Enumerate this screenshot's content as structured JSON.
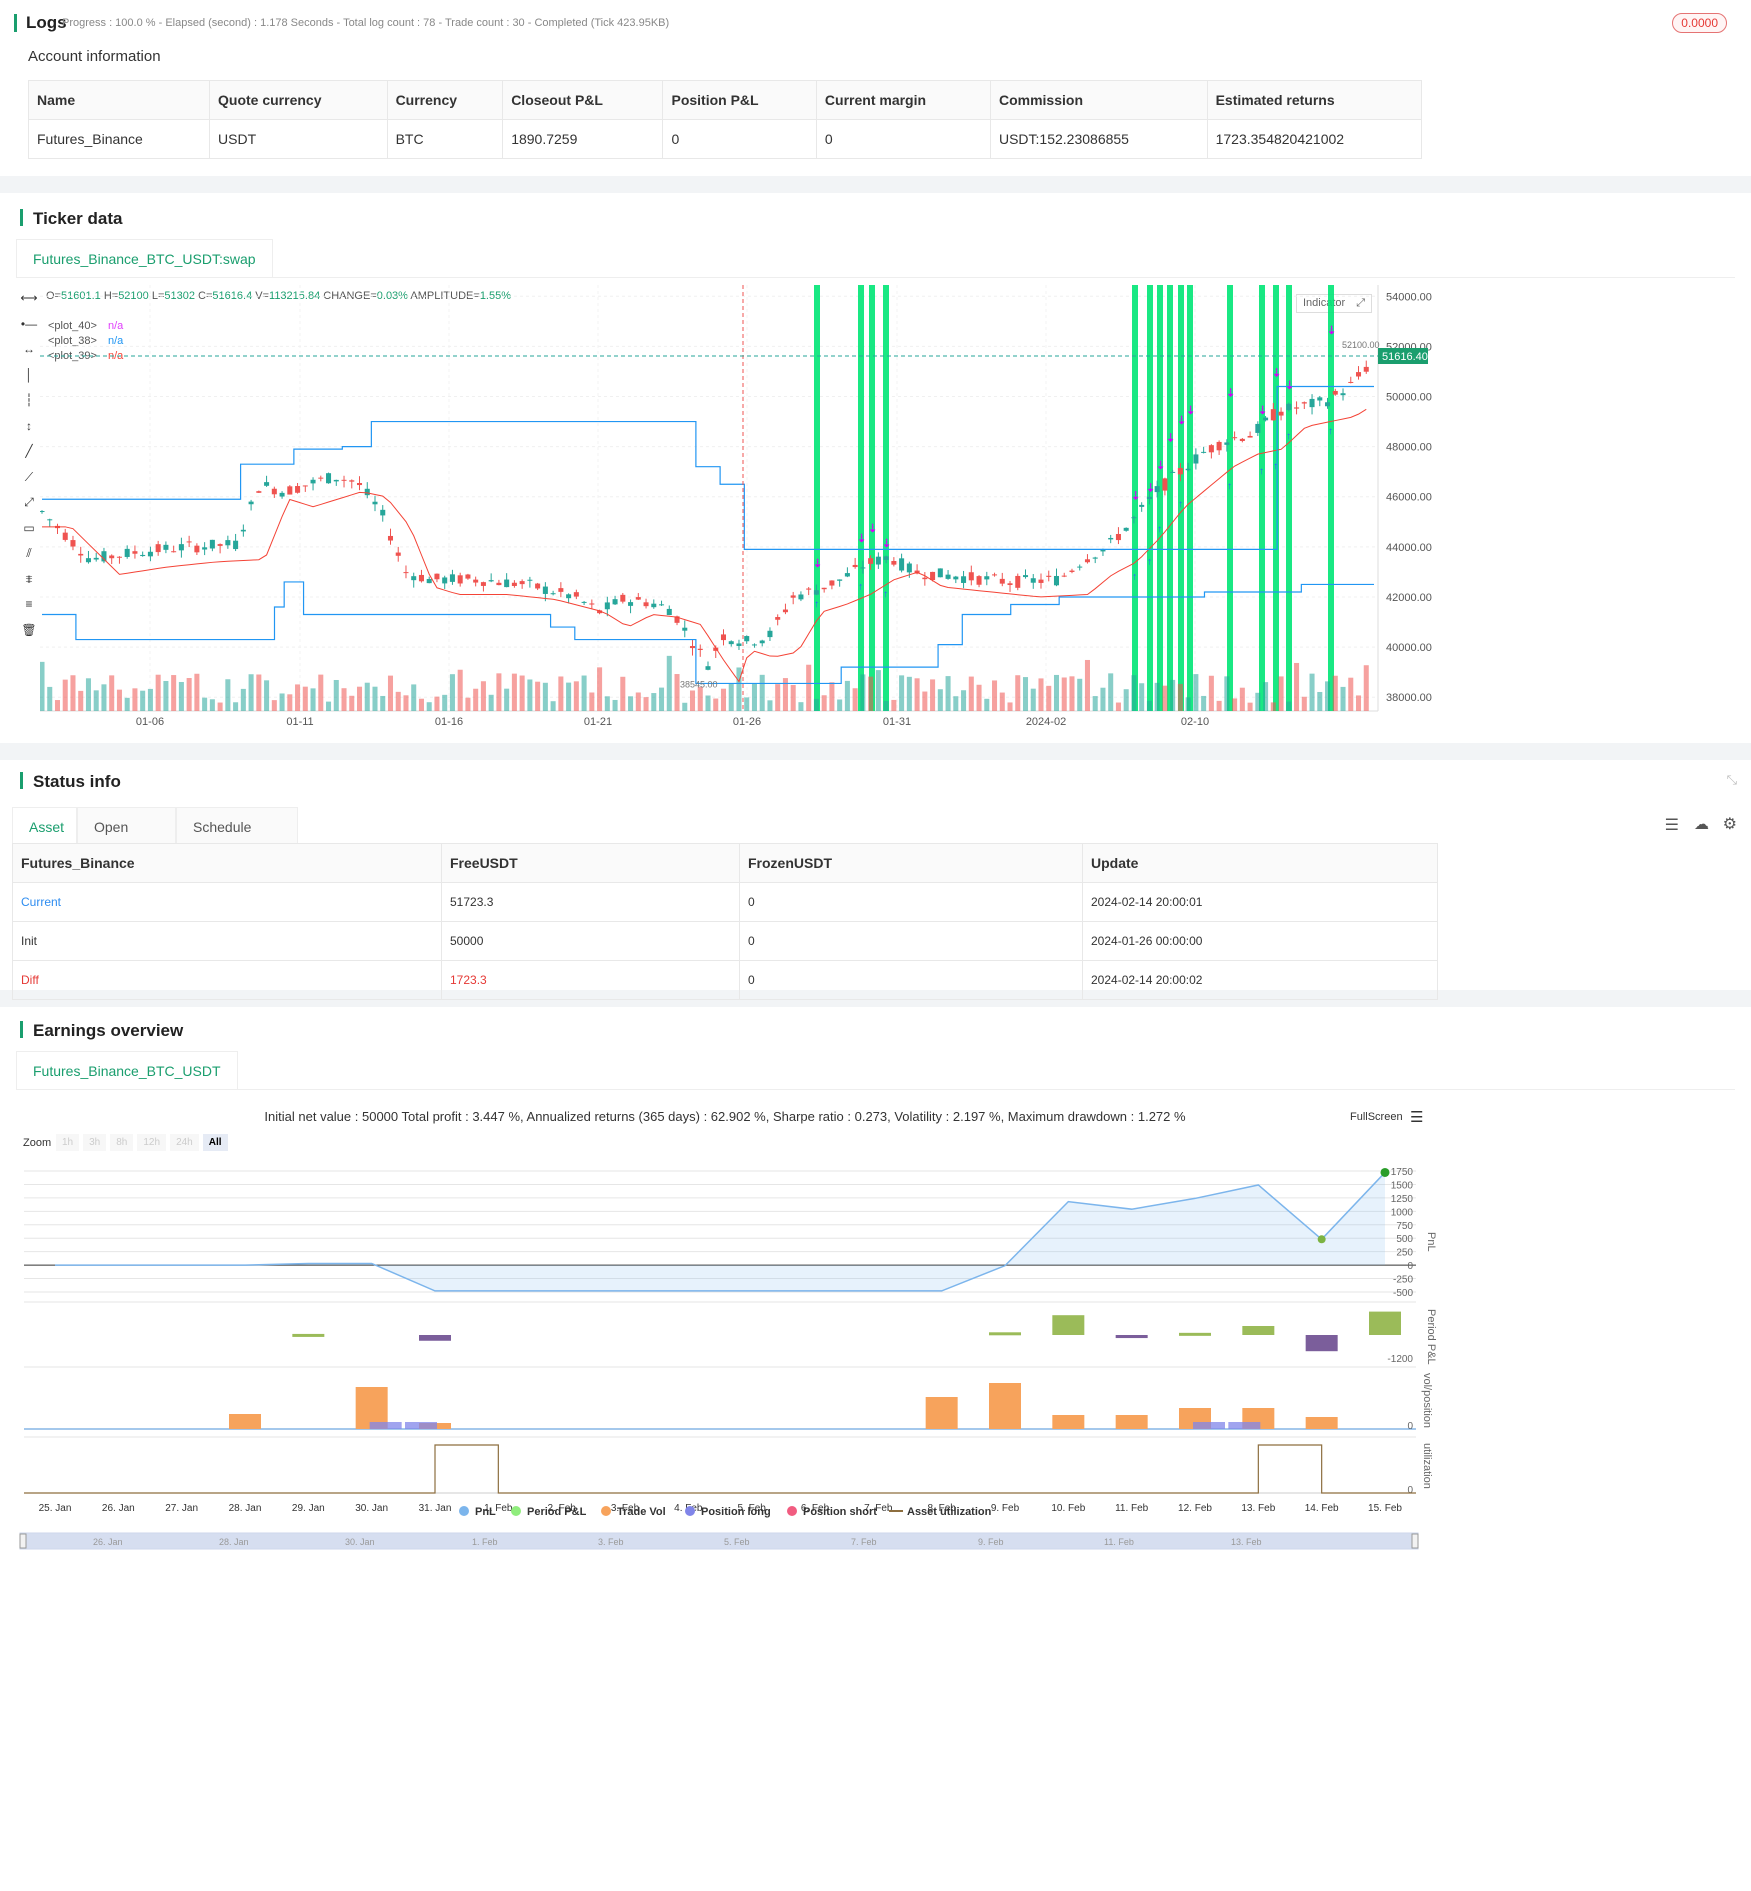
{
  "logs": {
    "title": "Logs",
    "status_line": "Progress : 100.0 % - Elapsed (second) : 1.178  Seconds - Total log count : 78 - Trade count : 30 - Completed (Tick 423.95KB)",
    "badge": "0.0000"
  },
  "account": {
    "title": "Account information",
    "headers": [
      "Name",
      "Quote currency",
      "Currency",
      "Closeout P&L",
      "Position P&L",
      "Current margin",
      "Commission",
      "Estimated returns"
    ],
    "row": [
      "Futures_Binance",
      "USDT",
      "BTC",
      "1890.7259",
      "0",
      "0",
      "USDT:152.23086855",
      "1723.354820421002"
    ]
  },
  "ticker": {
    "title": "Ticker data",
    "tab": "Futures_Binance_BTC_USDT:swap",
    "ohlc": {
      "o_label": "O=",
      "o": "51601.1",
      "h_label": "H=",
      "h": "52100",
      "l_label": "L=",
      "l": "51302",
      "c_label": "C=",
      "c": "51616.4",
      "v_label": "V=",
      "v": "113215.84",
      "change_label": "CHANGE=",
      "change": "0.03%",
      "amp_label": "AMPLITUDE=",
      "amp": "1.55%"
    },
    "legend": [
      {
        "name": "<plot_40>",
        "value": "n/a",
        "color": "#e040fb"
      },
      {
        "name": "<plot_38>",
        "value": "n/a",
        "color": "#2196f3"
      },
      {
        "name": "<plot_39>",
        "value": "n/a",
        "color": "#f44336"
      }
    ],
    "indicator_btn": "Indicator",
    "price_axis": [
      "54000.00",
      "52000.00",
      "50000.00",
      "48000.00",
      "46000.00",
      "44000.00",
      "42000.00",
      "40000.00",
      "38000.00"
    ],
    "price_values": [
      54000,
      52000,
      50000,
      48000,
      46000,
      44000,
      42000,
      40000,
      38000
    ],
    "last_price": "51616.40",
    "high_marker": "52100.00",
    "low_marker": "38545.00",
    "date_axis": [
      "01-06",
      "01-11",
      "01-16",
      "01-21",
      "01-26",
      "01-31",
      "2024-02",
      "02-10"
    ],
    "colors": {
      "up": "#26a69a",
      "down": "#ef5350",
      "signal": "#00e676",
      "upper": "#2196f3",
      "lower": "#f44336"
    }
  },
  "status": {
    "title": "Status info",
    "tabs": [
      "Asset",
      "Open orders",
      "Schedule orders"
    ],
    "headers": [
      "Futures_Binance",
      "FreeUSDT",
      "FrozenUSDT",
      "Update"
    ],
    "rows": [
      [
        "Current",
        "51723.3",
        "0",
        "2024-02-14 20:00:01"
      ],
      [
        "Init",
        "50000",
        "0",
        "2024-01-26 00:00:00"
      ],
      [
        "Diff",
        "1723.3",
        "0",
        "2024-02-14 20:00:02"
      ]
    ]
  },
  "earnings": {
    "title": "Earnings overview",
    "tab": "Futures_Binance_BTC_USDT",
    "summary": "Initial net value : 50000 Total profit : 3.447 %, Annualized returns (365 days) : 62.902 %, Sharpe ratio : 0.273, Volatility : 2.197 %, Maximum drawdown : 1.272 %",
    "fullscreen": "FullScreen",
    "zoom_label": "Zoom",
    "zoom_options": [
      "1h",
      "3h",
      "8h",
      "12h",
      "24h",
      "All"
    ],
    "pnl_axis": [
      "1750",
      "1500",
      "1250",
      "1000",
      "750",
      "500",
      "250",
      "0",
      "-250",
      "-500"
    ],
    "pnl_axis_title": "PnL",
    "period_axis_title": "Period P&L",
    "period_axis_min": "-1200",
    "vol_axis_title": "vol/position",
    "vol_axis_zero": "0",
    "util_axis_title": "utilization",
    "util_axis_zero": "0",
    "x_axis": [
      "25. Jan",
      "26. Jan",
      "27. Jan",
      "28. Jan",
      "29. Jan",
      "30. Jan",
      "31. Jan",
      "1. Feb",
      "2. Feb",
      "3. Feb",
      "4. Feb",
      "5. Feb",
      "6. Feb",
      "7. Feb",
      "8. Feb",
      "9. Feb",
      "10. Feb",
      "11. Feb",
      "12. Feb",
      "13. Feb",
      "14. Feb",
      "15. Feb"
    ],
    "legend": [
      {
        "name": "PnL",
        "color": "#7cb5ec"
      },
      {
        "name": "Period P&L",
        "color": "#90ed7d"
      },
      {
        "name": "Trade Vol",
        "color": "#f7a35c"
      },
      {
        "name": "Position long",
        "color": "#8085e9"
      },
      {
        "name": "Position short",
        "color": "#f15c80"
      },
      {
        "name": "Asset utilization",
        "color": "#8d6e3f"
      }
    ],
    "navigator": [
      "26. Jan",
      "28. Jan",
      "30. Jan",
      "1. Feb",
      "3. Feb",
      "5. Feb",
      "7. Feb",
      "9. Feb",
      "11. Feb",
      "13. Feb"
    ]
  },
  "chart_data": [
    {
      "type": "line",
      "title": "",
      "ylabel": "PnL",
      "x": [
        "25. Jan",
        "26. Jan",
        "27. Jan",
        "28. Jan",
        "29. Jan",
        "30. Jan",
        "31. Jan",
        "1. Feb",
        "2. Feb",
        "3. Feb",
        "4. Feb",
        "5. Feb",
        "6. Feb",
        "7. Feb",
        "8. Feb",
        "9. Feb",
        "10. Feb",
        "11. Feb",
        "12. Feb",
        "13. Feb",
        "14. Feb",
        "15. Feb"
      ],
      "series": [
        {
          "name": "PnL",
          "values": [
            0,
            0,
            0,
            0,
            30,
            30,
            -480,
            -480,
            -480,
            -480,
            -480,
            -480,
            -480,
            -480,
            -480,
            -10,
            1180,
            1040,
            1240,
            1490,
            480,
            1723
          ]
        }
      ],
      "ylim": [
        -500,
        1750
      ]
    },
    {
      "type": "bar",
      "ylabel": "Period P&L",
      "x": [
        "29. Jan",
        "31. Jan",
        "9. Feb",
        "10. Feb",
        "11. Feb",
        "12. Feb",
        "13. Feb",
        "14. Feb",
        "15. Feb"
      ],
      "series": [
        {
          "name": "Period P&L",
          "values": [
            60,
            -320,
            150,
            1100,
            -170,
            120,
            500,
            -900,
            1300
          ]
        }
      ]
    },
    {
      "type": "bar",
      "ylabel": "vol/position",
      "x": [
        "28. Jan",
        "30. Jan",
        "31. Jan",
        "8. Feb",
        "9. Feb",
        "10. Feb",
        "11. Feb",
        "12. Feb",
        "13. Feb",
        "14. Feb"
      ],
      "series": [
        {
          "name": "Trade Vol",
          "values": [
            1,
            2.6,
            0.4,
            2000,
            3000,
            1000,
            1000,
            1500,
            1500,
            1000
          ]
        },
        {
          "name": "Position long",
          "values": [
            0,
            0.5,
            0.5,
            0,
            0,
            0,
            0,
            0.5,
            0.5,
            0
          ]
        }
      ]
    }
  ]
}
